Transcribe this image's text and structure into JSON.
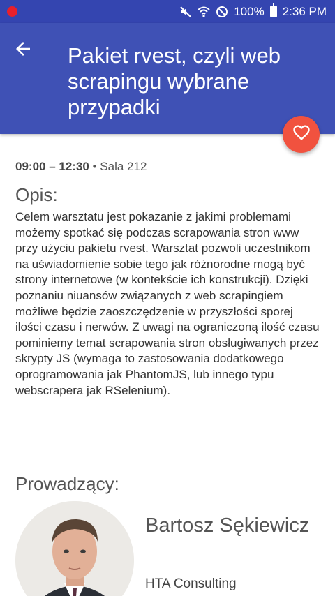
{
  "status_bar": {
    "battery_text": "100%",
    "time": "2:36 PM",
    "icons": [
      "notification-dot-icon",
      "mute-icon",
      "wifi-icon",
      "do-not-disturb-icon",
      "battery-icon"
    ]
  },
  "app_bar": {
    "title": "Pakiet rvest, czyli web scrapingu wybrane przypadki",
    "back_icon": "arrow-back-icon",
    "color": "#3f51b5"
  },
  "favorite_button": {
    "icon": "heart-outline-icon",
    "color": "#f1523f"
  },
  "session": {
    "time": "09:00 – 12:30",
    "separator": " • ",
    "room": "Sala 212"
  },
  "description": {
    "heading": "Opis:",
    "text": "Celem warsztatu jest pokazanie z jakimi problemami możemy spotkać się podczas scrapowania stron www przy użyciu pakietu rvest. Warsztat pozwoli uczestnikom na uświadomienie sobie tego jak różnorodne mogą być strony internetowe (w kontekście ich konstrukcji). Dzięki poznaniu niuansów związanych z web scrapingiem możliwe będzie zaoszczędzenie w przyszłości sporej ilości czasu i nerwów. Z uwagi na ograniczoną ilość czasu pominiemy temat scrapowania stron obsługiwanych przez skrypty JS (wymaga to zastosowania dodatkowego oprogramowania jak PhantomJS, lub innego typu webscrapera jak RSelenium)."
  },
  "speakers": {
    "heading": "Prowadzący:",
    "items": [
      {
        "name": "Bartosz Sękiewicz",
        "company": "HTA Consulting"
      }
    ]
  }
}
